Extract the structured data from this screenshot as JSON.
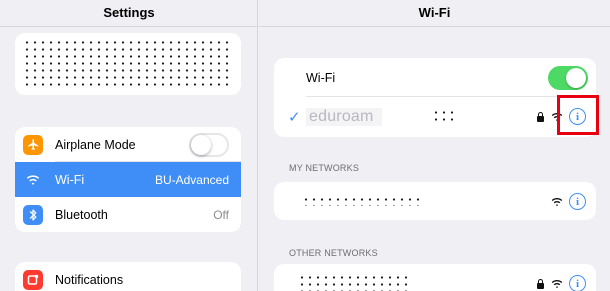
{
  "sidebar": {
    "title": "Settings",
    "items": [
      {
        "label": "Airplane Mode",
        "icon": "airplane-icon",
        "icon_color": "#ff9500",
        "toggle": "off"
      },
      {
        "label": "Wi-Fi",
        "icon": "wifi-icon",
        "icon_color": "#3f8ef7",
        "value": "BU-Advanced",
        "selected": true
      },
      {
        "label": "Bluetooth",
        "icon": "bluetooth-icon",
        "icon_color": "#3f8ef7",
        "value": "Off"
      }
    ],
    "items2": [
      {
        "label": "Notifications",
        "icon": "notifications-icon",
        "icon_color": "#ff3b30"
      }
    ]
  },
  "detail": {
    "title": "Wi-Fi",
    "wifi_toggle_label": "Wi-Fi",
    "wifi_enabled": true,
    "connected_network": "eduroam",
    "my_networks_header": "MY NETWORKS",
    "other_networks_header": "OTHER NETWORKS"
  },
  "colors": {
    "accent": "#3f8ef7",
    "toggle_on": "#4cd964",
    "highlight": "#e8000e"
  }
}
